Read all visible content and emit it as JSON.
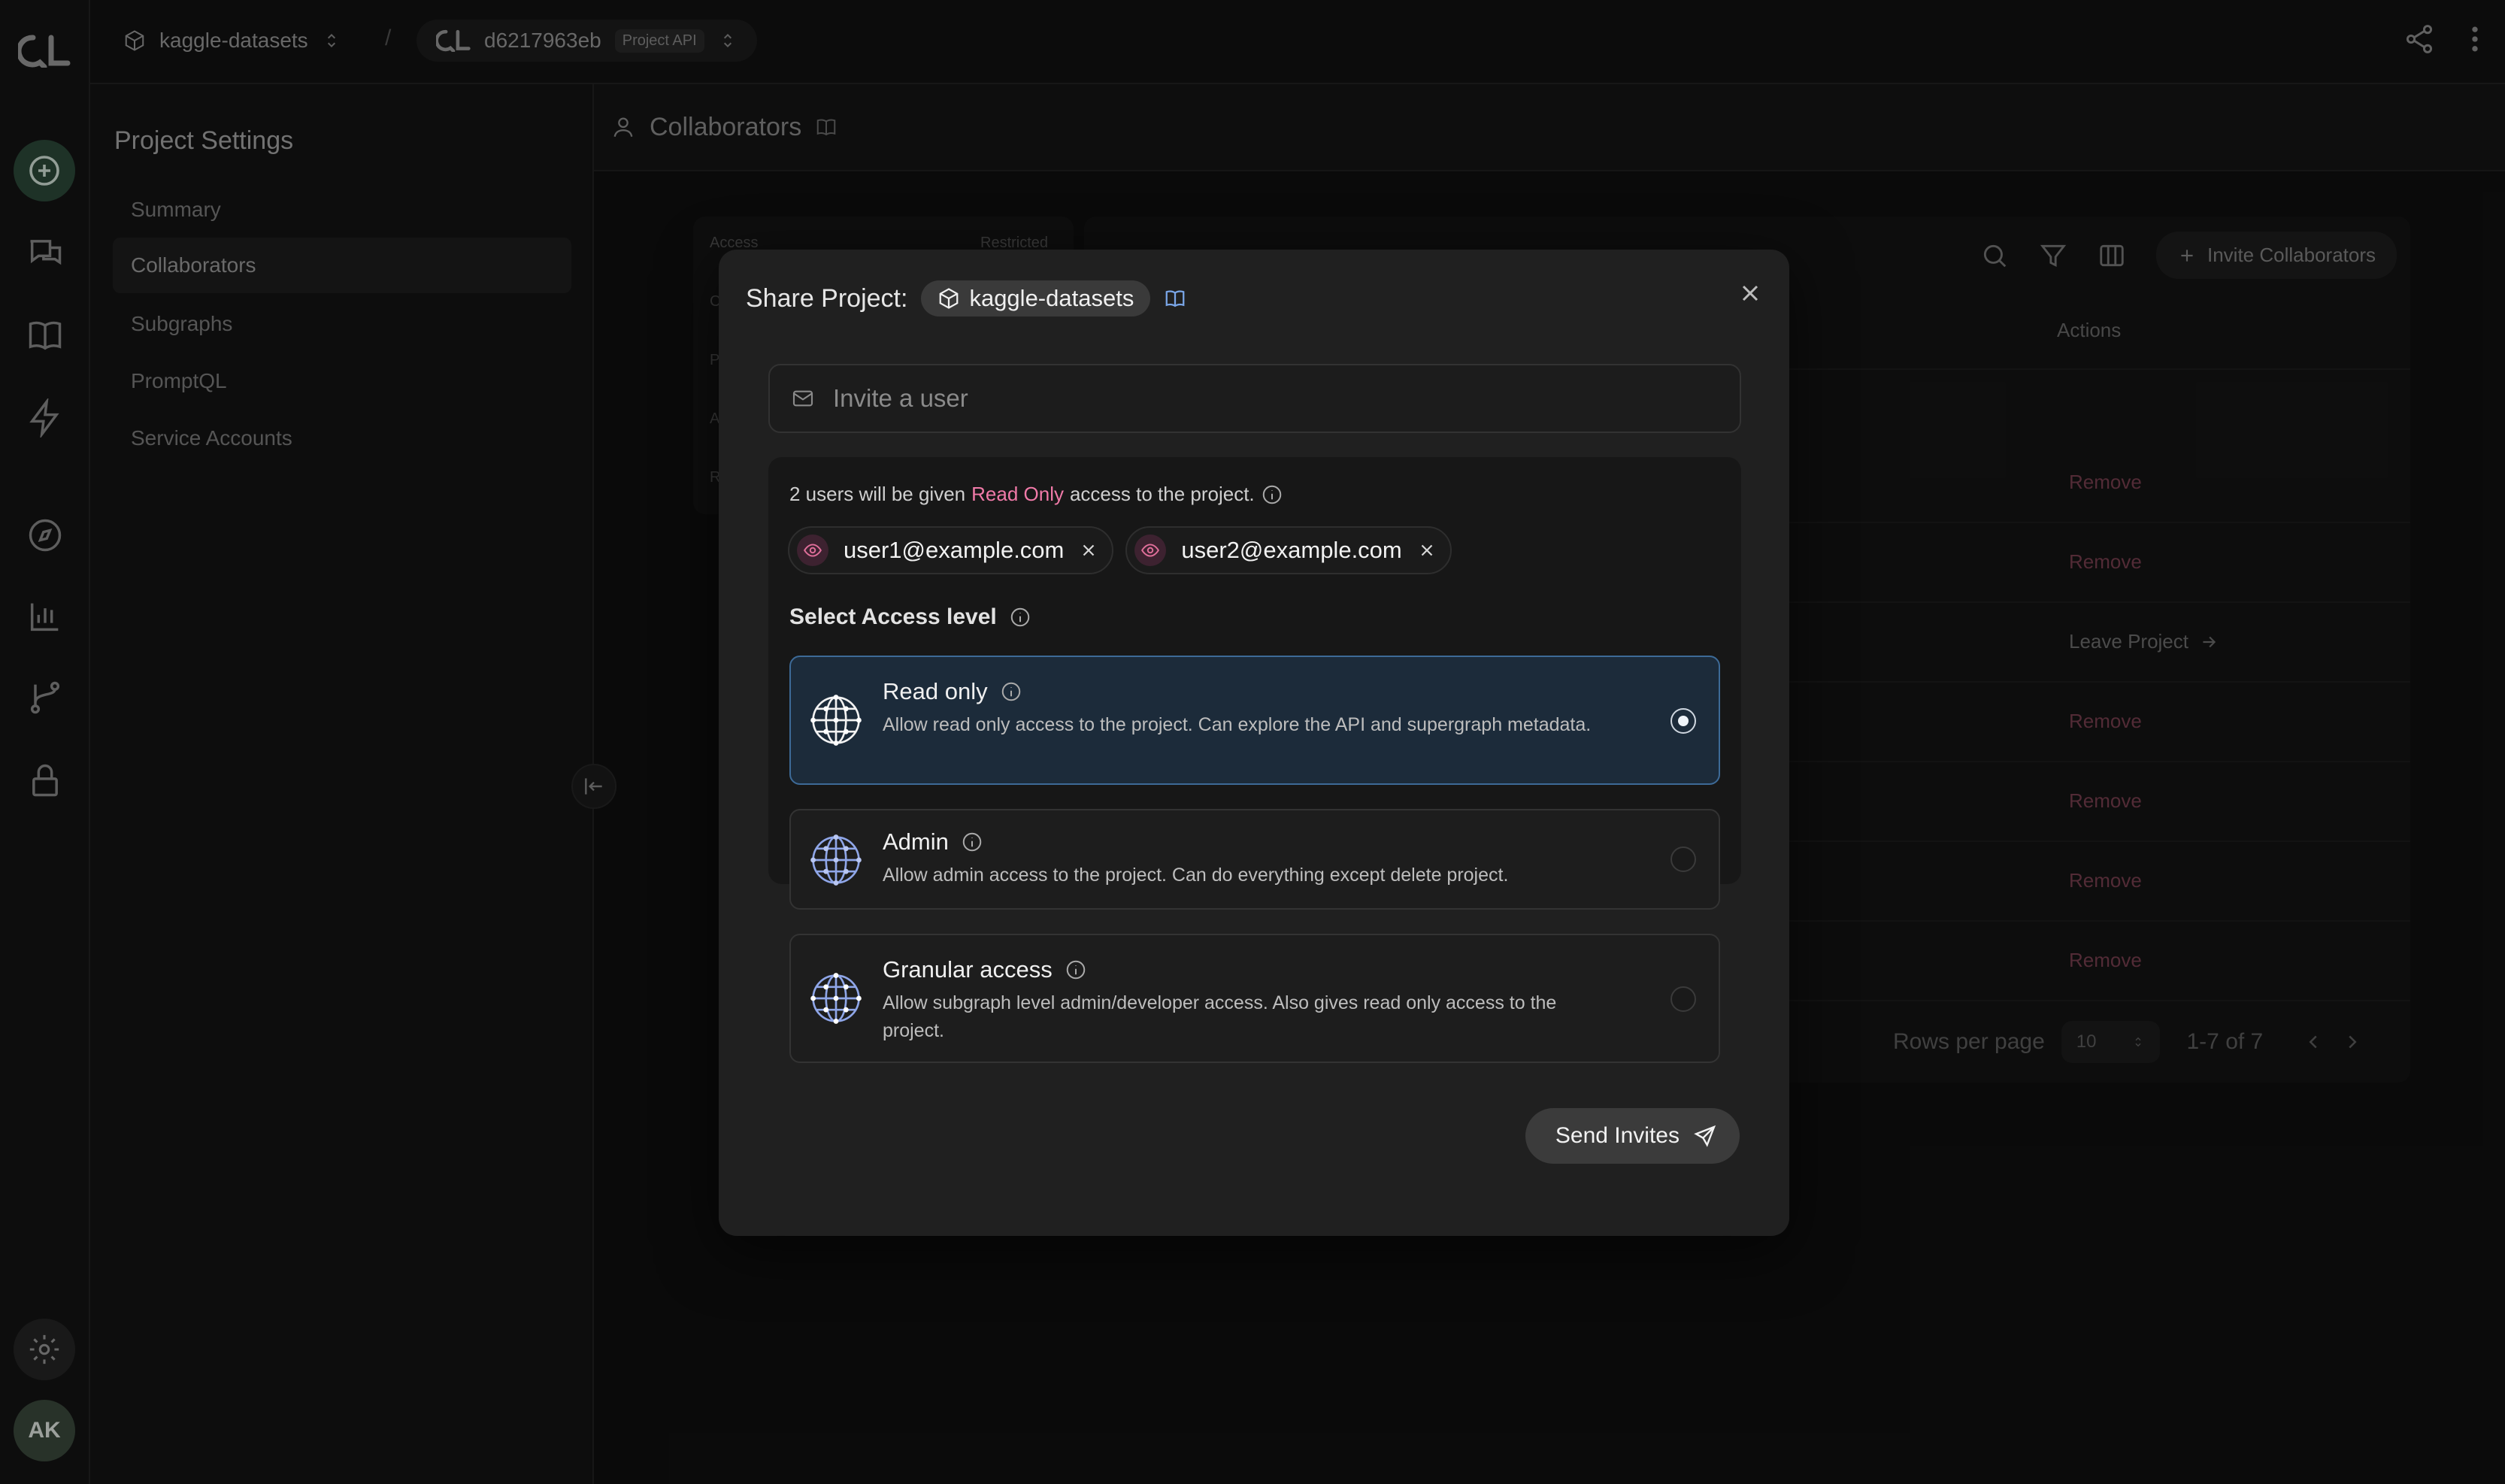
{
  "rail": {
    "logo": "QL",
    "avatar_initials": "AK",
    "icons": [
      "add-icon",
      "chat-icon",
      "book-icon",
      "bolt-icon",
      "compass-icon",
      "chart-icon",
      "branch-icon",
      "lock-icon",
      "gear-icon"
    ]
  },
  "topbar": {
    "project_name": "kaggle-datasets",
    "separator": "/",
    "build_id": "d6217963eb",
    "build_tag": "Project API"
  },
  "settings": {
    "title": "Project Settings",
    "items": [
      {
        "label": "Summary",
        "active": false
      },
      {
        "label": "Collaborators",
        "active": true
      },
      {
        "label": "Subgraphs",
        "active": false
      },
      {
        "label": "PromptQL",
        "active": false
      },
      {
        "label": "Service Accounts",
        "active": false
      }
    ]
  },
  "main": {
    "page_title": "Collaborators",
    "access_card": {
      "access_label": "Access",
      "restricted_label": "Restricted",
      "row_initials": [
        "C",
        "P",
        "A",
        "R"
      ]
    },
    "table": {
      "invite_button": "Invite Collaborators",
      "actions_header": "Actions",
      "rows": [
        "Remove",
        "Remove",
        "Leave Project",
        "Remove",
        "Remove",
        "Remove",
        "Remove"
      ],
      "rows_per_page_label": "Rows per page",
      "rows_per_page_value": "10",
      "range": "1-7 of 7"
    }
  },
  "modal": {
    "title": "Share Project:",
    "project_chip": "kaggle-datasets",
    "invite_placeholder": "Invite a user",
    "invite_value": "",
    "summary_prefix": "2 users will be given",
    "summary_highlight": "Read Only",
    "summary_suffix": "access to the project.",
    "users": [
      "user1@example.com",
      "user2@example.com"
    ],
    "select_label": "Select Access level",
    "options": [
      {
        "title": "Read only",
        "desc": "Allow read only access to the project. Can explore the API and supergraph metadata.",
        "selected": true
      },
      {
        "title": "Admin",
        "desc": "Allow admin access to the project. Can do everything except delete project.",
        "selected": false
      },
      {
        "title": "Granular access",
        "desc": "Allow subgraph level admin/developer access. Also gives read only access to the project.",
        "selected": false
      }
    ],
    "send_button": "Send Invites"
  },
  "colors": {
    "highlight_pink": "#f07aa8",
    "selected_option_bg": "#1c2b3a",
    "selected_option_border": "#3d6a97",
    "remove_link": "#7a4050"
  }
}
